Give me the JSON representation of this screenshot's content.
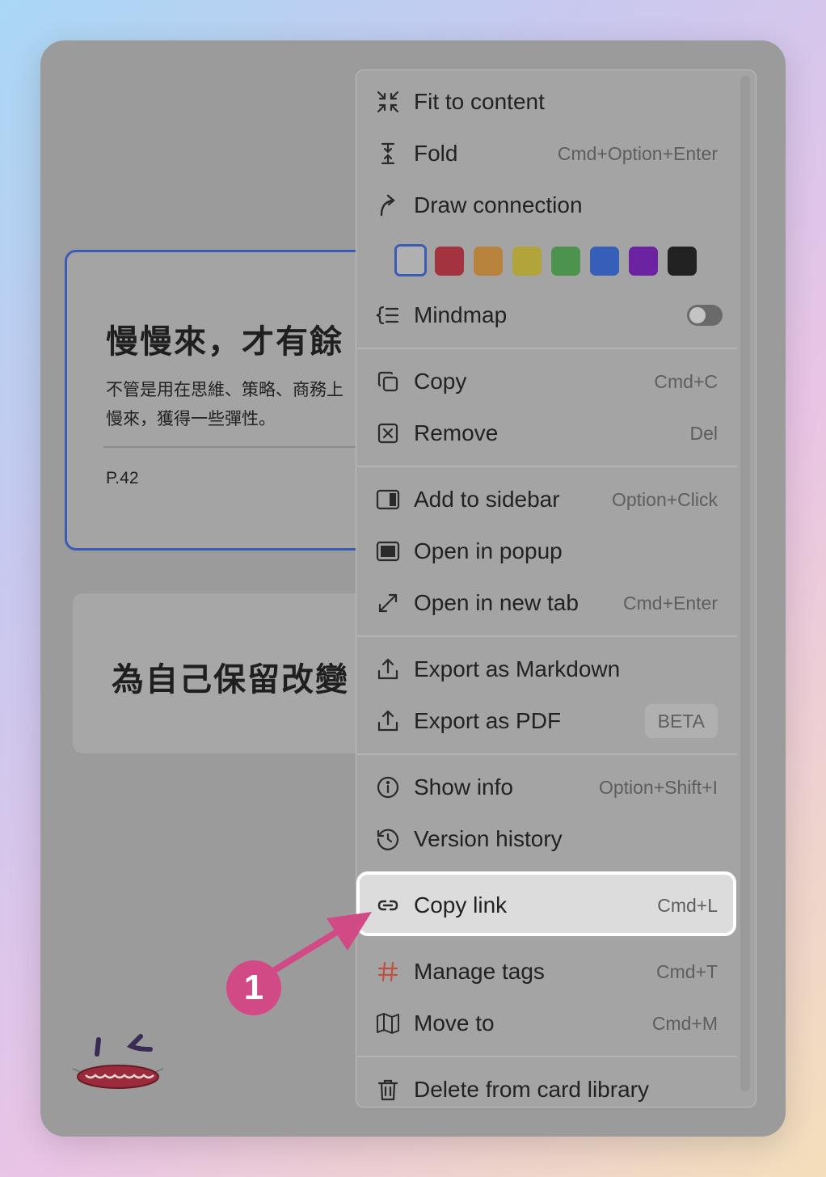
{
  "cards": {
    "card1_title": "慢慢來，才有餘",
    "card1_body_line1": "不管是用在思維、策略、商務上",
    "card1_body_line2": "慢來，獲得一些彈性。",
    "card1_page": "P.42",
    "card2_title": "為自己保留改變"
  },
  "menu": {
    "fit": {
      "label": "Fit to content",
      "icon": "fit-to-content-icon"
    },
    "fold": {
      "label": "Fold",
      "shortcut": "Cmd+Option+Enter",
      "icon": "fold-icon"
    },
    "draw": {
      "label": "Draw connection",
      "icon": "draw-connection-icon"
    },
    "colors": [
      "#b0b0b0",
      "#a3333f",
      "#b7833d",
      "#b2a33b",
      "#4c934e",
      "#365fba",
      "#6b23a1",
      "#222222"
    ],
    "mindmap": {
      "label": "Mindmap",
      "icon": "mindmap-icon",
      "enabled": false
    },
    "copy": {
      "label": "Copy",
      "shortcut": "Cmd+C",
      "icon": "copy-icon"
    },
    "remove": {
      "label": "Remove",
      "shortcut": "Del",
      "icon": "remove-icon"
    },
    "sidebar": {
      "label": "Add to sidebar",
      "shortcut": "Option+Click",
      "icon": "sidebar-icon"
    },
    "popup": {
      "label": "Open in popup",
      "icon": "popup-icon"
    },
    "newtab": {
      "label": "Open in new tab",
      "shortcut": "Cmd+Enter",
      "icon": "expand-icon"
    },
    "markdown": {
      "label": "Export as Markdown",
      "icon": "export-icon"
    },
    "pdf": {
      "label": "Export as PDF",
      "badge": "BETA",
      "icon": "export-icon"
    },
    "info": {
      "label": "Show info",
      "shortcut": "Option+Shift+I",
      "icon": "info-icon"
    },
    "history": {
      "label": "Version history",
      "icon": "history-icon"
    },
    "copylink": {
      "label": "Copy link",
      "shortcut": "Cmd+L",
      "icon": "link-icon"
    },
    "tags": {
      "label": "Manage tags",
      "shortcut": "Cmd+T",
      "icon": "hashtag-icon"
    },
    "moveto": {
      "label": "Move to",
      "shortcut": "Cmd+M",
      "icon": "map-icon"
    },
    "delete": {
      "label": "Delete from card library",
      "icon": "trash-icon"
    }
  },
  "annotation": {
    "step": "1",
    "accent": "#d14a86"
  }
}
